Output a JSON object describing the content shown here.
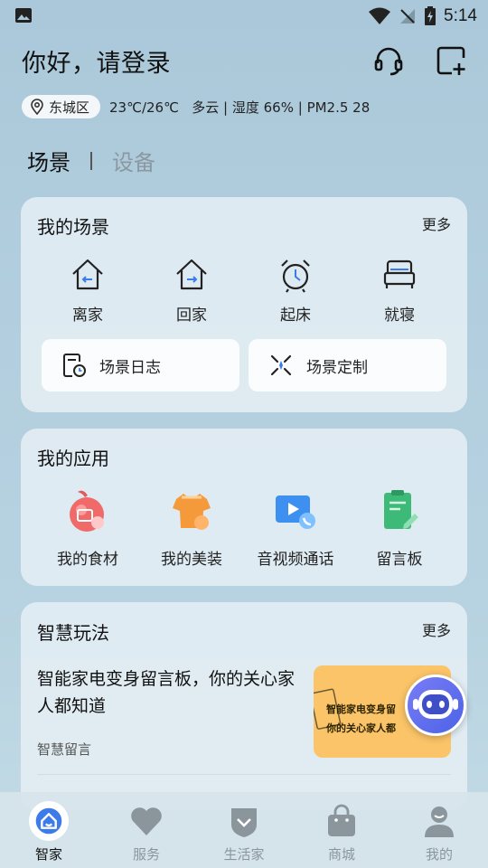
{
  "status_bar": {
    "time": "5:14"
  },
  "header": {
    "greeting": "你好，请登录"
  },
  "weather": {
    "location": "东城区",
    "temperature": "23℃/26℃",
    "condition": "多云",
    "humidity": "湿度 66%",
    "pm25": "PM2.5 28"
  },
  "tabs": [
    {
      "label": "场景",
      "active": true
    },
    {
      "label": "设备",
      "active": false
    }
  ],
  "my_scenes": {
    "title": "我的场景",
    "more": "更多",
    "items": [
      {
        "label": "离家",
        "icon": "leave-home-icon"
      },
      {
        "label": "回家",
        "icon": "return-home-icon"
      },
      {
        "label": "起床",
        "icon": "alarm-clock-icon"
      },
      {
        "label": "就寝",
        "icon": "bed-icon"
      }
    ],
    "buttons": [
      {
        "label": "场景日志",
        "icon": "scene-log-icon"
      },
      {
        "label": "场景定制",
        "icon": "scene-custom-icon"
      }
    ]
  },
  "my_apps": {
    "title": "我的应用",
    "items": [
      {
        "label": "我的食材",
        "icon": "food-icon"
      },
      {
        "label": "我的美装",
        "icon": "clothing-icon"
      },
      {
        "label": "音视频通话",
        "icon": "video-call-icon"
      },
      {
        "label": "留言板",
        "icon": "message-board-icon"
      }
    ]
  },
  "smart_play": {
    "title": "智慧玩法",
    "more": "更多",
    "description": "智能家电变身留言板，你的关心家人都知道",
    "subtitle": "智慧留言",
    "thumbnail_lines": [
      "智能家电变身留",
      "你的关心家人都"
    ]
  },
  "bottom_nav": [
    {
      "label": "智家",
      "active": true
    },
    {
      "label": "服务",
      "active": false
    },
    {
      "label": "生活家",
      "active": false
    },
    {
      "label": "商城",
      "active": false
    },
    {
      "label": "我的",
      "active": false
    }
  ],
  "colors": {
    "accent": "#3d7bea",
    "background": "#b3cfdf",
    "card": "#e8f0f5",
    "inactive": "#8b959c"
  }
}
